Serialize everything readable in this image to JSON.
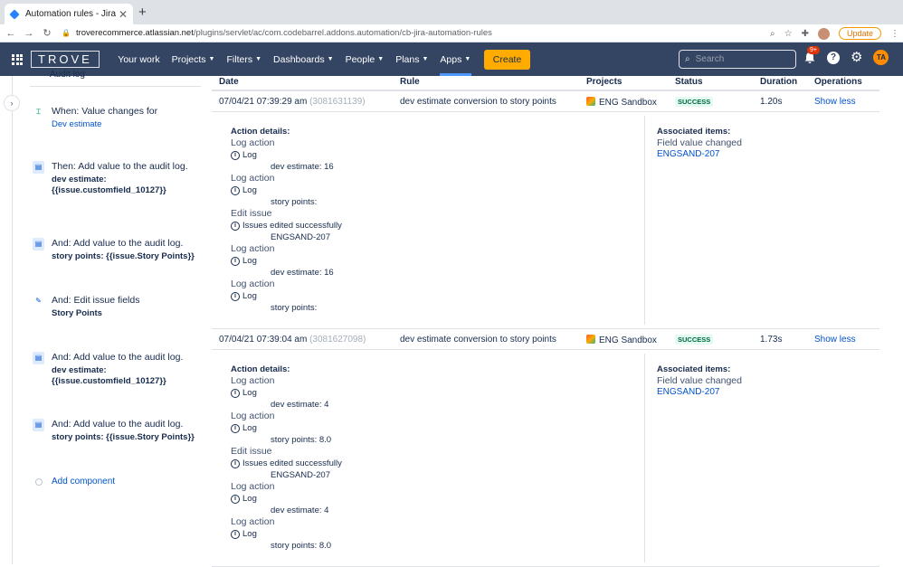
{
  "browser": {
    "tab_title": "Automation rules - Jira",
    "url_host": "troverecommerce.atlassian.net",
    "url_path": "/plugins/servlet/ac/com.codebarrel.addons.automation/cb-jira-automation-rules",
    "update_label": "Update"
  },
  "nav": {
    "logo": "TROVE",
    "items": [
      {
        "label": "Your work",
        "chevron": false
      },
      {
        "label": "Projects",
        "chevron": true
      },
      {
        "label": "Filters",
        "chevron": true
      },
      {
        "label": "Dashboards",
        "chevron": true
      },
      {
        "label": "People",
        "chevron": true
      },
      {
        "label": "Plans",
        "chevron": true
      },
      {
        "label": "Apps",
        "chevron": true
      }
    ],
    "create_label": "Create",
    "search_placeholder": "Search",
    "notif_badge": "9+",
    "user_initials": "TA"
  },
  "rule_panel": {
    "partial_label": "Audit log",
    "components": [
      {
        "title": "When: Value changes for",
        "sub": "Dev estimate",
        "icon": "trigger-icon"
      },
      {
        "title": "Then: Add value to the audit log.",
        "sub": "dev estimate: {{issue.customfield_10127}}",
        "icon": "audit-log-icon"
      },
      {
        "title": "And: Add value to the audit log.",
        "sub": "story points: {{issue.Story Points}}",
        "icon": "audit-log-icon"
      },
      {
        "title": "And: Edit issue fields",
        "sub": "Story Points",
        "icon": "edit-icon"
      },
      {
        "title": "And: Add value to the audit log.",
        "sub": "dev estimate: {{issue.customfield_10127}}",
        "icon": "audit-log-icon"
      },
      {
        "title": "And: Add value to the audit log.",
        "sub": "story points: {{issue.Story Points}}",
        "icon": "audit-log-icon"
      }
    ],
    "add_component_label": "Add component"
  },
  "table": {
    "headers": {
      "date": "Date",
      "rule": "Rule",
      "projects": "Projects",
      "status": "Status",
      "duration": "Duration",
      "operations": "Operations"
    },
    "rows": [
      {
        "date": "07/04/21 07:39:29 am",
        "id": "(3081631139)",
        "rule": "dev estimate conversion to story points",
        "project": "ENG Sandbox",
        "status": "SUCCESS",
        "duration": "1.20s",
        "operation": "Show less",
        "details_label": "Action details:",
        "actions": [
          {
            "action": "Log action",
            "type": "Log",
            "value": "dev estimate: 16"
          },
          {
            "action": "Log action",
            "type": "Log",
            "value": "story points:"
          },
          {
            "action": "Edit issue",
            "type": "Issues edited successfully",
            "value": "ENGSAND-207"
          },
          {
            "action": "Log action",
            "type": "Log",
            "value": "dev estimate: 16"
          },
          {
            "action": "Log action",
            "type": "Log",
            "value": "story points:"
          }
        ],
        "assoc_label": "Associated items:",
        "assoc_sub": "Field value changed",
        "assoc_link": "ENGSAND-207"
      },
      {
        "date": "07/04/21 07:39:04 am",
        "id": "(3081627098)",
        "rule": "dev estimate conversion to story points",
        "project": "ENG Sandbox",
        "status": "SUCCESS",
        "duration": "1.73s",
        "operation": "Show less",
        "details_label": "Action details:",
        "actions": [
          {
            "action": "Log action",
            "type": "Log",
            "value": "dev estimate: 4"
          },
          {
            "action": "Log action",
            "type": "Log",
            "value": "story points: 8.0"
          },
          {
            "action": "Edit issue",
            "type": "Issues edited successfully",
            "value": "ENGSAND-207"
          },
          {
            "action": "Log action",
            "type": "Log",
            "value": "dev estimate: 4"
          },
          {
            "action": "Log action",
            "type": "Log",
            "value": "story points: 8.0"
          }
        ],
        "assoc_label": "Associated items:",
        "assoc_sub": "Field value changed",
        "assoc_link": "ENGSAND-207"
      }
    ]
  }
}
